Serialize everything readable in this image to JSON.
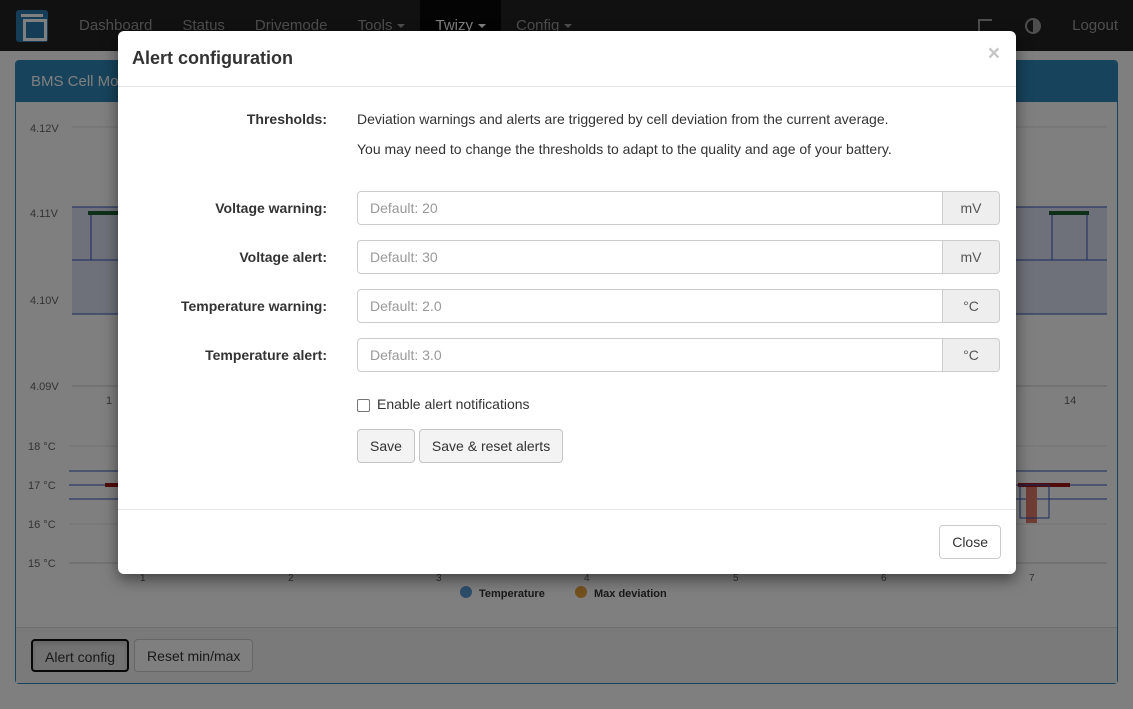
{
  "navbar": {
    "items": [
      "Dashboard",
      "Status",
      "Drivemode",
      "Tools",
      "Twizy",
      "Config"
    ],
    "active": "Twizy",
    "logout": "Logout",
    "icons": [
      "app-logo-icon",
      "tablet-icon",
      "contrast-icon"
    ]
  },
  "panel": {
    "title": "BMS Cell Monitor",
    "buttons": {
      "alert_config": "Alert config",
      "reset_minmax": "Reset min/max"
    }
  },
  "chart_data": [
    {
      "type": "bar",
      "title": "",
      "y_tick_labels": [
        "4.12V",
        "4.11V",
        "4.10V",
        "4.09V"
      ],
      "ylim": [
        4.09,
        4.12
      ],
      "x_visible_tick_labels": [
        "1",
        "14"
      ]
    },
    {
      "type": "bar",
      "title": "",
      "y_tick_labels": [
        "18 °C",
        "17 °C",
        "16 °C",
        "15 °C"
      ],
      "ylim": [
        15,
        18
      ],
      "categories": [
        "1",
        "2",
        "3",
        "4",
        "5",
        "6",
        "7"
      ],
      "series": [
        {
          "name": "Temperature"
        },
        {
          "name": "Max deviation"
        }
      ],
      "legend": "bottom",
      "colors": {
        "temperature": "#5b9bd5",
        "max_deviation": "#e8a33d"
      }
    }
  ],
  "modal": {
    "title": "Alert configuration",
    "close_symbol": "×",
    "thresholds": {
      "label": "Thresholds:",
      "line1": "Deviation warnings and alerts are triggered by cell deviation from the current average.",
      "line2": "You may need to change the thresholds to adapt to the quality and age of your battery."
    },
    "fields": [
      {
        "label": "Voltage warning:",
        "placeholder": "Default: 20",
        "unit": "mV"
      },
      {
        "label": "Voltage alert:",
        "placeholder": "Default: 30",
        "unit": "mV"
      },
      {
        "label": "Temperature warning:",
        "placeholder": "Default: 2.0",
        "unit": "°C"
      },
      {
        "label": "Temperature alert:",
        "placeholder": "Default: 3.0",
        "unit": "°C"
      }
    ],
    "notifications_label": "Enable alert notifications",
    "buttons": {
      "save": "Save",
      "save_reset": "Save & reset alerts",
      "close": "Close"
    }
  }
}
